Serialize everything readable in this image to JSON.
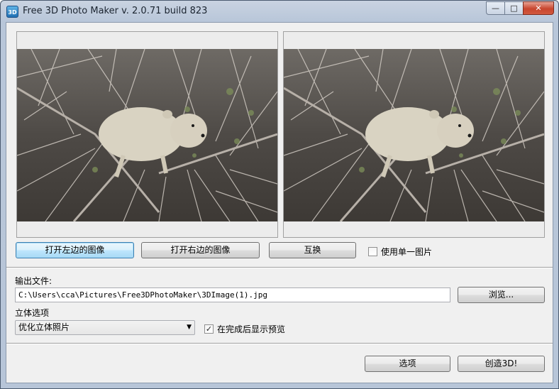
{
  "window": {
    "app_icon_text": "3D",
    "title": "Free 3D Photo Maker  v. 2.0.71 build 823",
    "min_icon": "minimize-icon",
    "max_icon": "maximize-icon",
    "close_icon": "close-icon"
  },
  "images": {
    "left_alt": "left-image-preview",
    "right_alt": "right-image-preview"
  },
  "buttons": {
    "open_left": "打开左边的图像",
    "open_right": "打开右边的图像",
    "swap": "互换",
    "browse": "浏览...",
    "options": "选项",
    "create": "创造3D!"
  },
  "single_image": {
    "label": "使用单一图片",
    "checked": false
  },
  "output": {
    "label": "输出文件:",
    "path": "C:\\Users\\cca\\Pictures\\Free3DPhotoMaker\\3DImage(1).jpg"
  },
  "stereo": {
    "label": "立体选项",
    "selected": "优化立体照片"
  },
  "preview_after": {
    "label": "在完成后显示预览",
    "checked": true
  }
}
